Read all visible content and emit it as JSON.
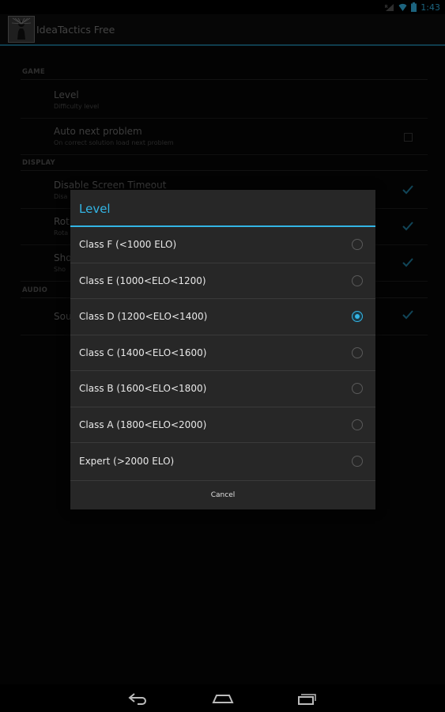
{
  "status_bar": {
    "time": "1:43"
  },
  "app": {
    "title": "IdeaTactics Free"
  },
  "prefs": {
    "sections": [
      {
        "header": "GAME"
      },
      {
        "header": "DISPLAY"
      },
      {
        "header": "AUDIO"
      }
    ],
    "items": [
      {
        "title": "Level",
        "summary": "Difficulty level"
      },
      {
        "title": "Auto next problem",
        "summary": "On correct solution load next problem",
        "checked": false
      },
      {
        "title": "Disable Screen Timeout",
        "summary": "Disa",
        "checked": true
      },
      {
        "title": "Rot",
        "summary": "Rota",
        "checked": true
      },
      {
        "title": "Sho",
        "summary": "Sho",
        "checked": true
      },
      {
        "title": "Sou",
        "summary": "",
        "checked": true
      }
    ]
  },
  "dialog": {
    "title": "Level",
    "options": [
      {
        "label": "Class F (<1000 ELO)",
        "selected": false
      },
      {
        "label": "Class E (1000<ELO<1200)",
        "selected": false
      },
      {
        "label": "Class D (1200<ELO<1400)",
        "selected": true
      },
      {
        "label": "Class C (1400<ELO<1600)",
        "selected": false
      },
      {
        "label": "Class B (1600<ELO<1800)",
        "selected": false
      },
      {
        "label": "Class A (1800<ELO<2000)",
        "selected": false
      },
      {
        "label": "Expert (>2000 ELO)",
        "selected": false
      }
    ],
    "cancel_label": "Cancel"
  },
  "nav": {
    "icons": [
      "back-icon",
      "home-icon",
      "recent-apps-icon"
    ]
  },
  "colors": {
    "accent": "#33b5e5",
    "background": "#000000",
    "dialog": "#272727"
  }
}
